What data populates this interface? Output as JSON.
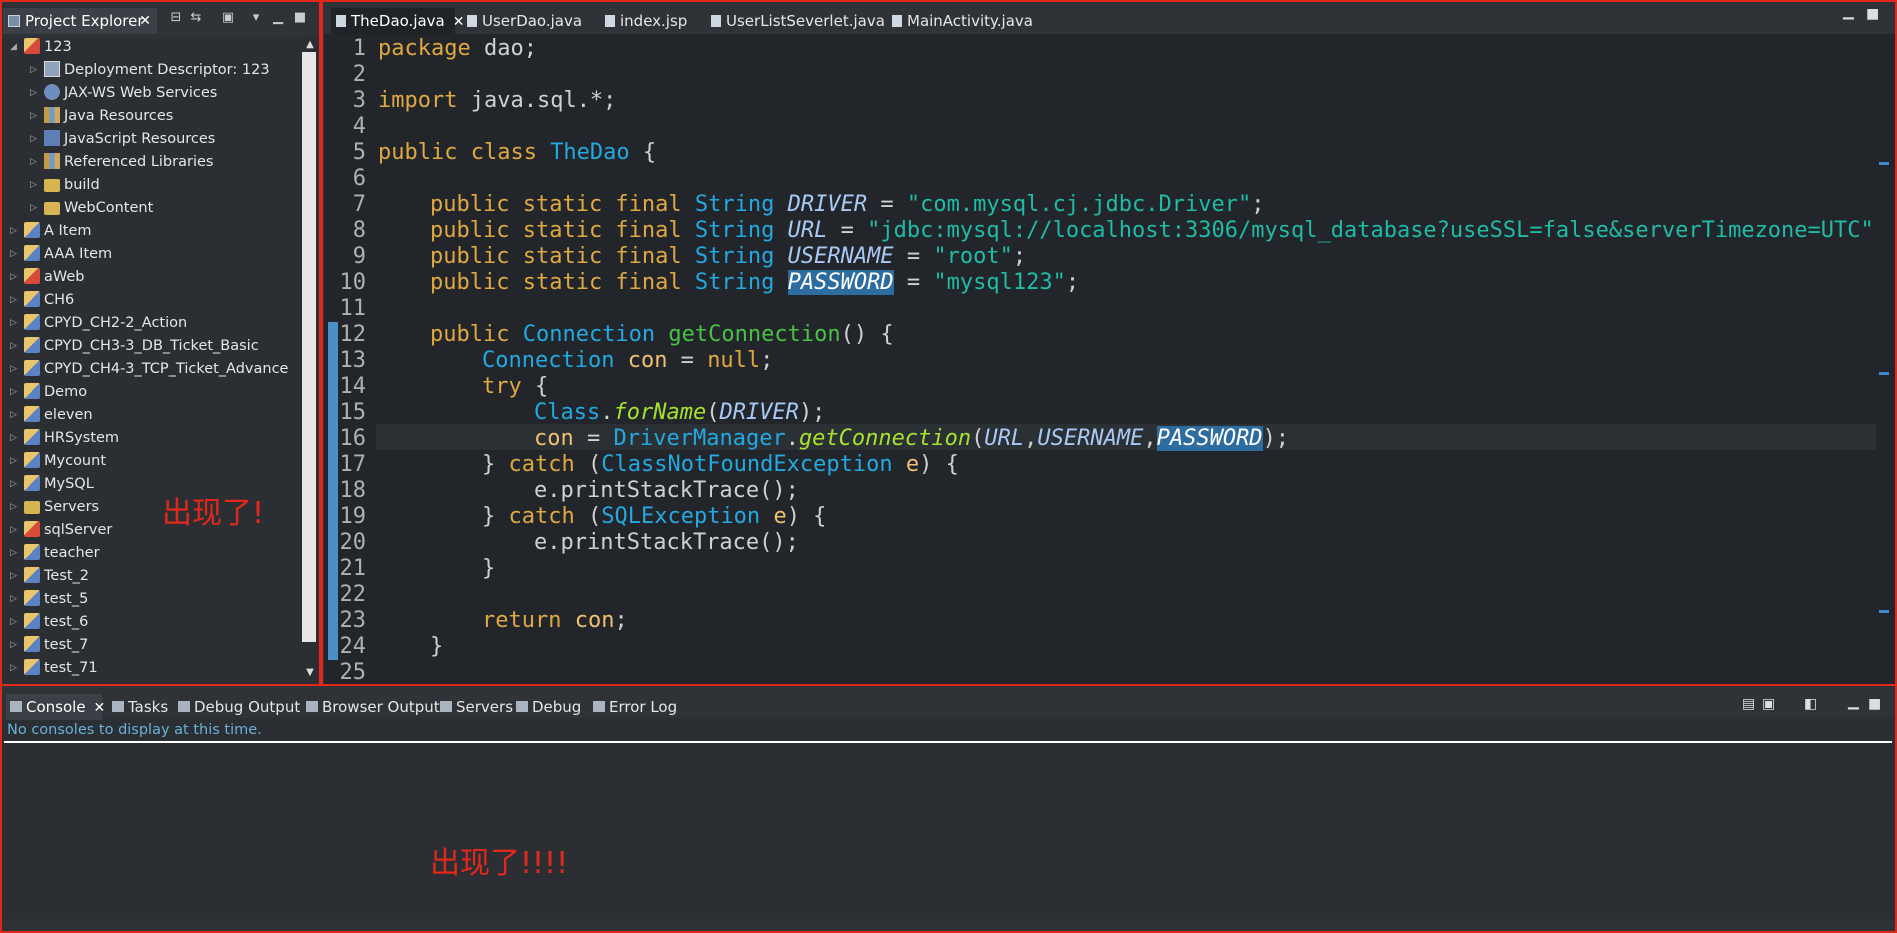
{
  "explorer": {
    "tab_label": "Project Explorer",
    "close_glyph": "✕",
    "items": [
      {
        "label": "123",
        "expanded": true,
        "level": 0,
        "icon": "web-project-icon"
      },
      {
        "label": "Deployment Descriptor: 123",
        "level": 1,
        "icon": "descriptor-icon"
      },
      {
        "label": "JAX-WS Web Services",
        "level": 1,
        "icon": "webservice-icon"
      },
      {
        "label": "Java Resources",
        "level": 1,
        "icon": "library-icon"
      },
      {
        "label": "JavaScript Resources",
        "level": 1,
        "icon": "javascript-icon"
      },
      {
        "label": "Referenced Libraries",
        "level": 1,
        "icon": "library-icon"
      },
      {
        "label": "build",
        "level": 1,
        "icon": "folder-icon"
      },
      {
        "label": "WebContent",
        "level": 1,
        "icon": "folder-icon"
      },
      {
        "label": "A Item",
        "level": 0,
        "icon": "project-icon"
      },
      {
        "label": "AAA Item",
        "level": 0,
        "icon": "project-icon"
      },
      {
        "label": "aWeb",
        "level": 0,
        "icon": "web-project-icon"
      },
      {
        "label": "CH6",
        "level": 0,
        "icon": "project-icon"
      },
      {
        "label": "CPYD_CH2-2_Action",
        "level": 0,
        "icon": "project-icon"
      },
      {
        "label": "CPYD_CH3-3_DB_Ticket_Basic",
        "level": 0,
        "icon": "project-icon"
      },
      {
        "label": "CPYD_CH4-3_TCP_Ticket_Advance",
        "level": 0,
        "icon": "project-icon"
      },
      {
        "label": "Demo",
        "level": 0,
        "icon": "project-icon"
      },
      {
        "label": "eleven",
        "level": 0,
        "icon": "project-icon"
      },
      {
        "label": "HRSystem",
        "level": 0,
        "icon": "project-icon"
      },
      {
        "label": "Mycount",
        "level": 0,
        "icon": "project-icon"
      },
      {
        "label": "MySQL",
        "level": 0,
        "icon": "project-icon"
      },
      {
        "label": "Servers",
        "level": 0,
        "icon": "folder-icon"
      },
      {
        "label": "sqlServer",
        "level": 0,
        "icon": "web-project-icon"
      },
      {
        "label": "teacher",
        "level": 0,
        "icon": "project-icon"
      },
      {
        "label": "Test_2",
        "level": 0,
        "icon": "project-icon"
      },
      {
        "label": "test_5",
        "level": 0,
        "icon": "project-icon"
      },
      {
        "label": "test_6",
        "level": 0,
        "icon": "project-icon"
      },
      {
        "label": "test_7",
        "level": 0,
        "icon": "project-icon"
      },
      {
        "label": "test_71",
        "level": 0,
        "icon": "project-icon"
      }
    ],
    "annotation": "出现了!"
  },
  "editor": {
    "tabs": [
      {
        "label": "TheDao.java",
        "active": true
      },
      {
        "label": "UserDao.java"
      },
      {
        "label": "index.jsp"
      },
      {
        "label": "UserListSeverlet.java"
      },
      {
        "label": "MainActivity.java"
      }
    ],
    "line_numbers": [
      "1",
      "2",
      "3",
      "4",
      "5",
      "6",
      "7",
      "8",
      "9",
      "10",
      "11",
      "12",
      "13",
      "14",
      "15",
      "16",
      "17",
      "18",
      "19",
      "20",
      "21",
      "22",
      "23",
      "24",
      "25"
    ],
    "code": {
      "l1_kw": "package",
      "l1_rest": " dao;",
      "l3_kw": "import",
      "l3_rest": " java.sql.*;",
      "l5_kw": "public class ",
      "l5_cls": "TheDao",
      "l5_rest": " {",
      "mods": "public static final ",
      "string_type": "String",
      "f_driver": "DRIVER",
      "v_driver": "\"com.mysql.cj.jdbc.Driver\"",
      "f_url": "URL",
      "v_url": "\"jdbc:mysql://localhost:3306/mysql_database?useSSL=false&serverTimezone=UTC\"",
      "f_user": "USERNAME",
      "v_user": "\"root\"",
      "f_pass": "PASSWORD",
      "v_pass": "\"mysql123\"",
      "assign": " = ",
      "semi": ";",
      "l12_kw": "public ",
      "l12_type": "Connection",
      "l12_fn": "getConnection",
      "l12_rest": "() {",
      "l13_type": "Connection",
      "l13_var": " con",
      "l13_rest": " = ",
      "l13_null": "null",
      "l13_end": ";",
      "l14_kw": "try",
      "l14_rest": " {",
      "l15_cls": "Class",
      "dot": ".",
      "l15_m": "forName",
      "l15_arg": "DRIVER",
      "l15_end": ");",
      "l16_var": "con",
      "l16_cls": "DriverManager",
      "l16_m": "getConnection",
      "l16_end": ");",
      "close_brace": "}",
      "catch_kw": "catch",
      "l17_ex": "ClassNotFoundException",
      "l19_ex": "SQLException",
      "e_var": "e",
      "e_call": "e.printStackTrace();",
      "l23_kw": "return",
      "l23_var": " con",
      "l23_end": ";"
    }
  },
  "console": {
    "tabs": [
      {
        "label": "Console",
        "active": true
      },
      {
        "label": "Tasks"
      },
      {
        "label": "Debug Output"
      },
      {
        "label": "Browser Output"
      },
      {
        "label": "Servers"
      },
      {
        "label": "Debug"
      },
      {
        "label": "Error Log"
      }
    ],
    "message": "No consoles to display at this time.",
    "annotation": "出现了!!!!"
  },
  "colors": {
    "annotation_red": "#e3281b",
    "keyword": "#e0a840",
    "type": "#23a9e1",
    "string": "#1fbba6"
  }
}
